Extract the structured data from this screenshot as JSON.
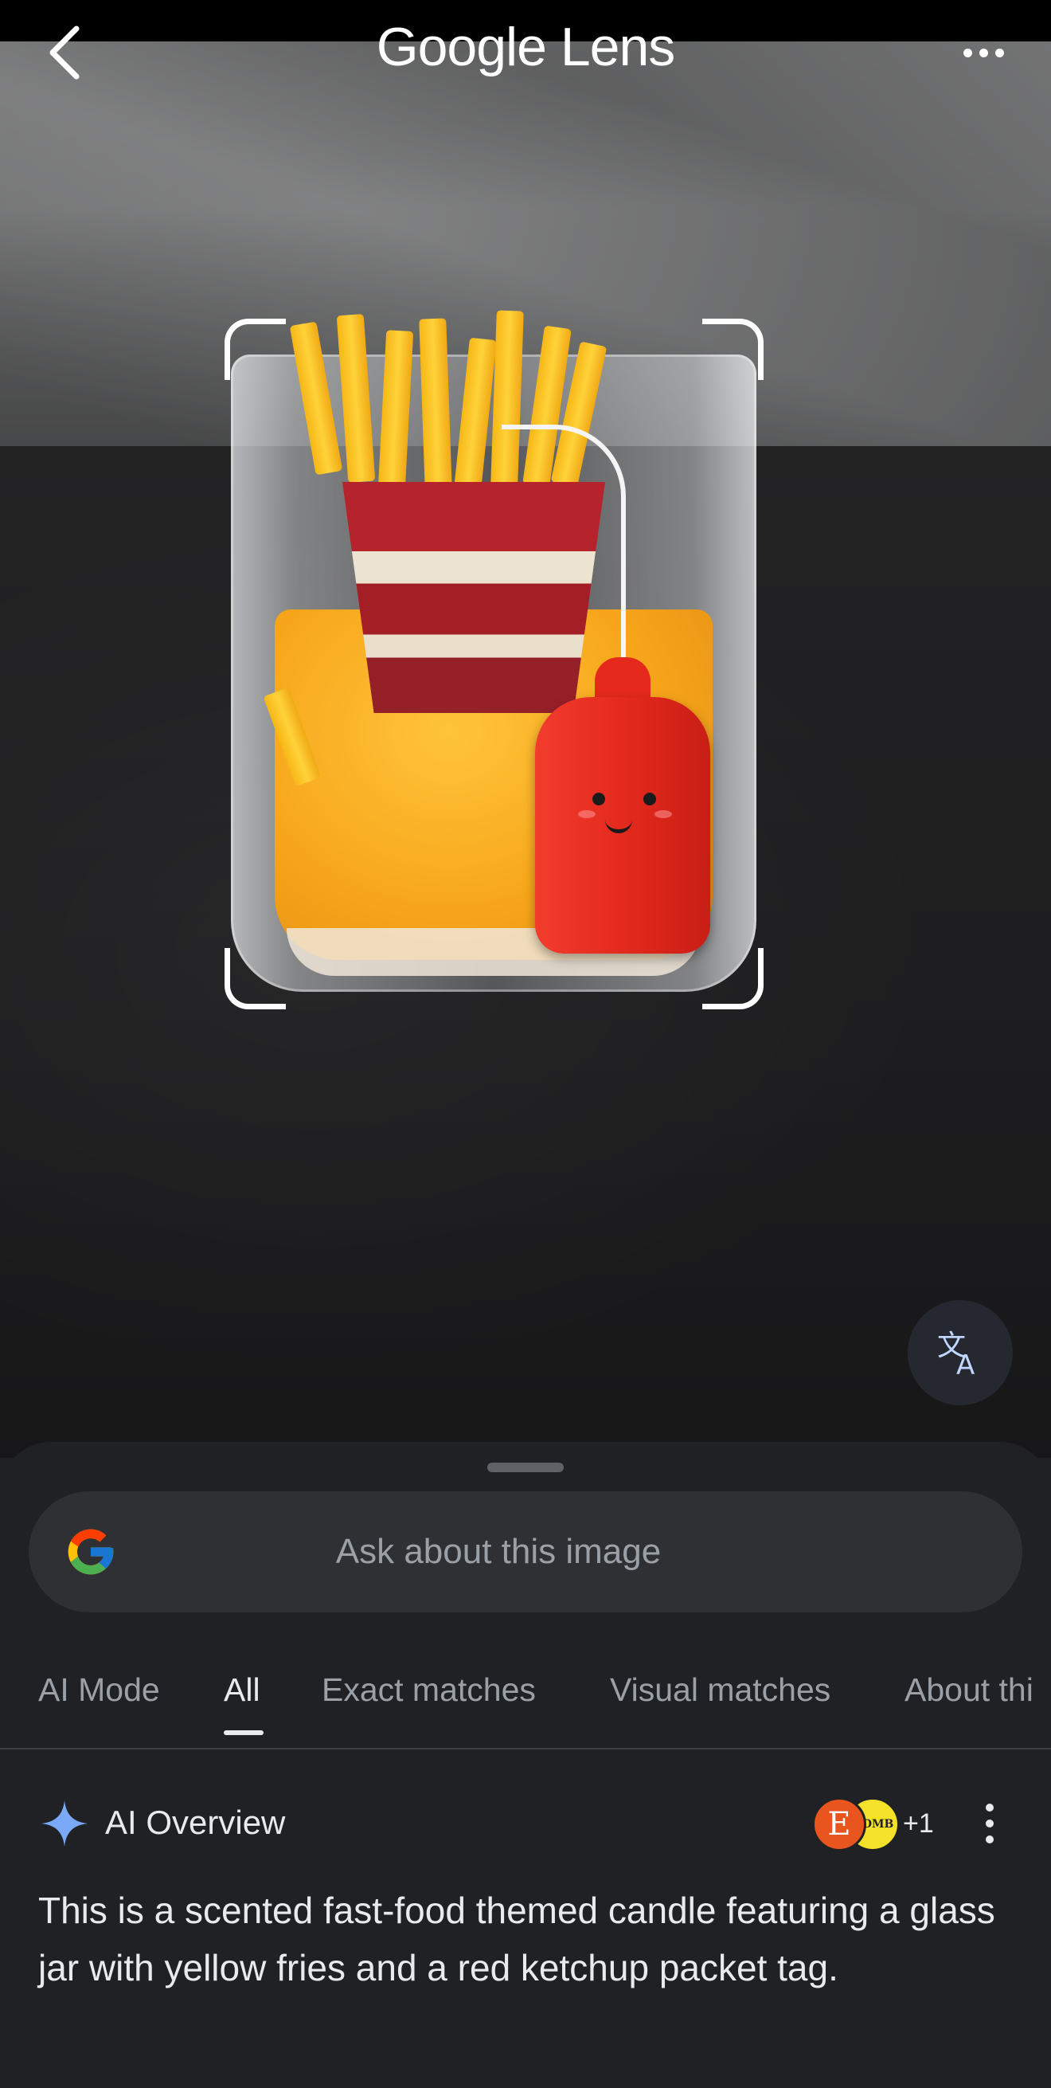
{
  "header": {
    "title": "Google Lens",
    "back_icon": "chevron-left-icon",
    "more_icon": "more-horizontal-icon"
  },
  "image": {
    "subject": "candle photo",
    "translate_icon": "translate-icon"
  },
  "search": {
    "placeholder": "Ask about this image",
    "logo_icon": "google-g-icon"
  },
  "tabs": [
    {
      "label": "AI Mode",
      "active": false
    },
    {
      "label": "All",
      "active": true
    },
    {
      "label": "Exact matches",
      "active": false
    },
    {
      "label": "Visual matches",
      "active": false
    },
    {
      "label": "About thi",
      "active": false
    }
  ],
  "ai_overview": {
    "title": "AI Overview",
    "source_initial": "E",
    "source_badge_text": "HOMB",
    "more_sources": "+1",
    "text": "This is a scented fast-food themed candle featuring a glass jar with yellow fries and a red ketchup packet tag."
  },
  "colors": {
    "sheet_bg": "#202124",
    "pill_bg": "#2f3034",
    "text_primary": "#e8eaed",
    "text_secondary": "#9aa0a6",
    "accent_spark": "#7aa9f7"
  }
}
